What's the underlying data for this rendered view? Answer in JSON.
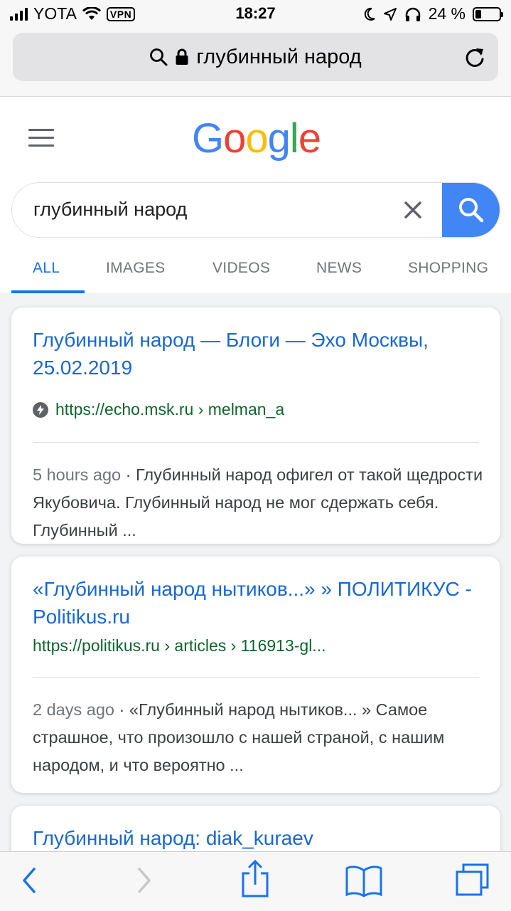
{
  "status_bar": {
    "carrier": "YOTA",
    "vpn": "VPN",
    "time": "18:27",
    "battery": "24 %",
    "battery_level": 0.24
  },
  "address_bar": {
    "text": "глубинный народ"
  },
  "google": {
    "logo_letters": [
      {
        "char": "G",
        "color": "#4285f4"
      },
      {
        "char": "o",
        "color": "#ea4335"
      },
      {
        "char": "o",
        "color": "#fbbc05"
      },
      {
        "char": "g",
        "color": "#4285f4"
      },
      {
        "char": "l",
        "color": "#34a853"
      },
      {
        "char": "e",
        "color": "#ea4335"
      }
    ],
    "search_value": "глубинный народ",
    "tabs": [
      {
        "label": "ALL",
        "active": true
      },
      {
        "label": "IMAGES",
        "active": false
      },
      {
        "label": "VIDEOS",
        "active": false
      },
      {
        "label": "NEWS",
        "active": false
      },
      {
        "label": "SHOPPING",
        "active": false
      }
    ]
  },
  "results": [
    {
      "title": "Глубинный народ — Блоги — Эхо Москвы, 25.02.2019",
      "url": "https://echo.msk.ru › melman_a",
      "amp": true,
      "date": "5 hours ago",
      "snippet": "Глубинный народ офигел от такой щедрости Якубовича. Глубинный народ не мог сдержать себя. Глубинный ..."
    },
    {
      "title": "«Глубинный народ нытиков...» » ПОЛИТИКУС - Politikus.ru",
      "url": "https://politikus.ru › articles › 116913-gl...",
      "amp": false,
      "date": "2 days ago",
      "snippet": "«Глубинный народ нытиков... » Самое страшное, что произошло с нашей страной, с нашим народом, и что вероятно ..."
    },
    {
      "title": "Глубинный народ: diak_kuraev"
    }
  ],
  "colors": {
    "link_blue": "#1967d2",
    "url_green": "#0d652d",
    "accent_blue": "#1a73e8",
    "search_button": "#4285f4"
  }
}
